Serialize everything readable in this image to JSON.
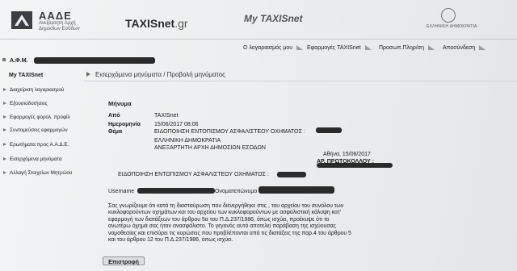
{
  "header": {
    "logo_title": "ΑΑΔΕ",
    "logo_subtitle_line1": "Ανεξάρτητη Αρχή",
    "logo_subtitle_line2": "Δημοσίων Εσόδων",
    "brand_name": "TAXISnet",
    "brand_suffix": ".gr",
    "app_title": "My TAXISnet",
    "government_label": "ΕΛΛΗΝΙΚΗ ΔΗΜΟΚΡΑΤΙΑ"
  },
  "topnav": {
    "account": "Ο λογαριασμός μου",
    "apps": "Εφαρμογές TAXISnet",
    "personal_info": "Προσωπ.Πληρ/ση",
    "logout": "Αποσύνδεση"
  },
  "sidebar": {
    "afm_label": "Α.Φ.Μ.",
    "user_label": "My TAXISnet",
    "items": [
      {
        "label": "Διαχείριση λογαριασμού"
      },
      {
        "label": "Εξουσιοδοτήσεις"
      },
      {
        "label": "Εφαρμογές φορολ. προφίλ"
      },
      {
        "label": "Συντομεύσεις εφαρμογών"
      },
      {
        "label": "Ερωτήματα προς Α.Α.Δ.Ε."
      },
      {
        "label": "Εισερχόμενα μηνύματα"
      },
      {
        "label": "Αλλαγή Στοιχείων Μητρώου"
      }
    ]
  },
  "breadcrumb": "Εισερχόμενα μηνύματα / Προβολή μηνύματος",
  "message": {
    "section_title": "Μήνυμα",
    "from_label": "Από",
    "from_value": "TAXISnet",
    "date_label": "Ημερομηνία",
    "date_value": "15/06/2017 08:06",
    "subject_label": "Θέμα",
    "subject_value": "ΕΙΔΟΠΟΙΗΣΗ ΕΝΤΟΠΙΣΜΟΥ ΑΣΦΑΛΙΣΤΕΟΥ ΟΧΗΜΑΤΟΣ :",
    "sender_line1": "ΕΛΛΗΝΙΚΗ ΔΗΜΟΚΡΑΤΙΑ",
    "sender_line2": "ΑΝΕΞΑΡΤΗΤΗ ΑΡΧΗ ΔΗΜΟΣΙΩΝ ΕΣΟΔΩΝ",
    "place_date": "Αθήνα, 15/06/2017",
    "protocol_label": "ΑΡ. ΠΡΩΤΟΚΟΛΛΟΥ :",
    "notice_title": "ΕΙΔΟΠΟΙΗΣΗ ΕΝΤΟΠΙΣΜΟΥ ΑΣΦΑΛΙΣΤΕΟΥ ΟΧΗΜΑΤΟΣ :",
    "username_label": "Username",
    "fullname_label": "Ονοματεπώνυμο",
    "body_lines": [
      "Σας γνωρίζουμε ότι κατά τη διασταύρωση που διενεργήθηκε στις , του αρχείου του συνόλου των",
      "κυκλοφορούντων οχημάτων και του αρχείου των κυκλοφορούντων με ασφαλιστική κάλυψη κατ'",
      "εφαρμογή των διατάξεων του άρθρου 5α του Π.Δ.237/1986, όπως ισχύει, προέκυψε ότι το",
      "ανωτέρω όχημά σας ήταν ανασφάλιστο. Το γεγονός αυτό αποτελεί παράβαση της ισχύουσας",
      "νομοθεσίας και επισύρει τις κυρώσεις που προβλέπονται από τις διατάξεις της παρ.4 του άρθρου 5",
      "και του άρθρου 12 του Π.Δ.237/1986, όπως ισχύει."
    ]
  },
  "actions": {
    "back": "Επιστροφή"
  }
}
